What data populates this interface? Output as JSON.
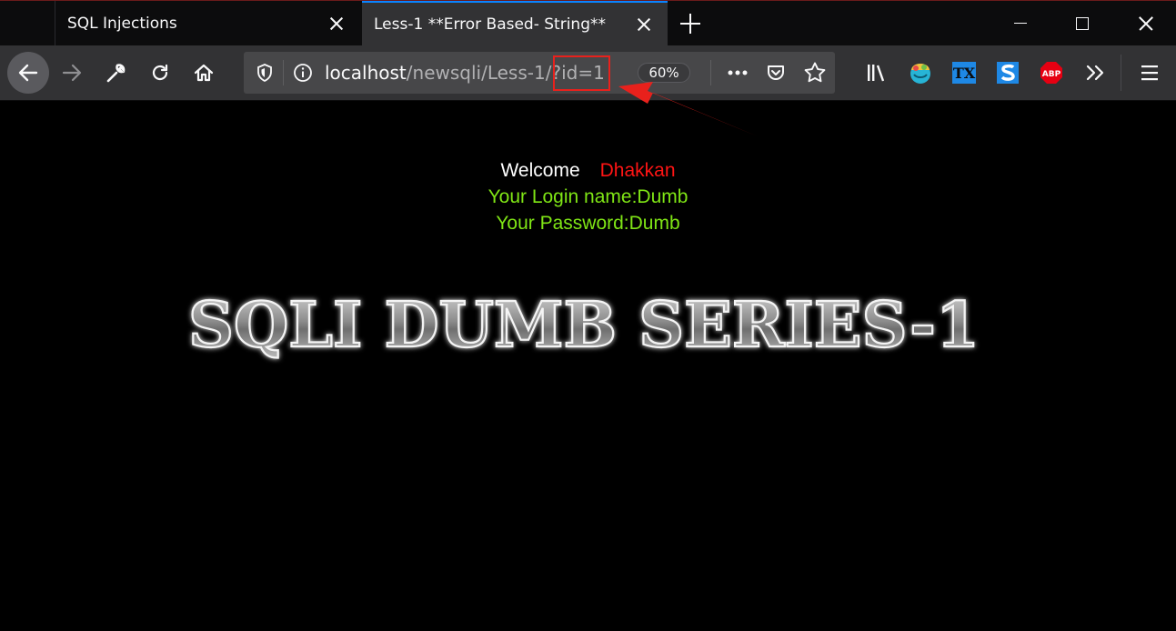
{
  "browser": {
    "tabs": [
      {
        "label": "SQL Injections",
        "active": false
      },
      {
        "label": "Less-1 **Error Based- String**",
        "active": true
      }
    ],
    "url": {
      "host": "localhost",
      "path": "/newsqli/Less-1/",
      "query": "?id=1"
    },
    "zoom": "60%",
    "extensions": [
      "library-icon",
      "colorful-extension-icon",
      "tx-icon",
      "s-icon",
      "abp-icon"
    ],
    "abp_label": "ABP",
    "tx_label": "TX"
  },
  "page": {
    "welcome": "Welcome",
    "username": "Dhakkan",
    "login_line": "Your Login name:Dumb",
    "password_line": "Your Password:Dumb",
    "banner": "SQLI DUMB SERIES-1"
  },
  "colors": {
    "welcome": "#ffffff",
    "username": "#ff1414",
    "credentials": "#7fe515",
    "highlight": "#e8211c"
  }
}
